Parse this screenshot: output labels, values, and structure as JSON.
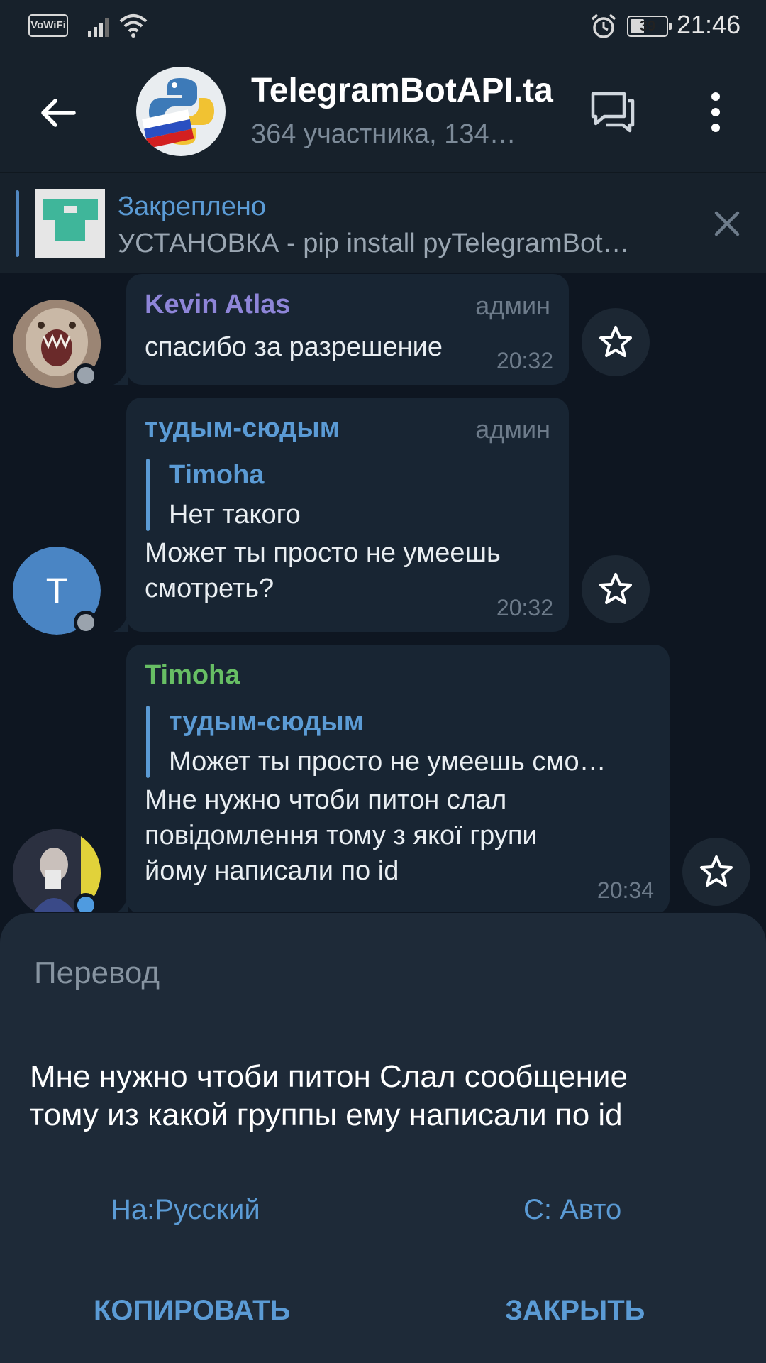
{
  "status_bar": {
    "vowifi": "VoWiFi",
    "battery": "39",
    "battery_level": 0.39,
    "time": "21:46",
    "icons": [
      "signal-icon",
      "wifi-icon",
      "alarm-icon",
      "battery-icon"
    ]
  },
  "header": {
    "title": "TelegramBotAPI.ta",
    "subtitle": "364 участника, 134…",
    "icons": [
      "back-arrow-icon",
      "discussion-icon",
      "more-vert-icon"
    ]
  },
  "pinned": {
    "title": "Закреплено",
    "text": "УСТАНОВКА - pip install pyTelegramBot…"
  },
  "messages": [
    {
      "sender": "Kevin Atlas",
      "sender_color": "#8e85d8",
      "badge": "админ",
      "text": "спасибо за разрешение",
      "time": "20:32"
    },
    {
      "sender": "тудым-сюдым",
      "sender_color": "#5b9bd5",
      "badge": "админ",
      "avatar_letter": "T",
      "avatar_color": "#4a85c4",
      "reply_name": "Timoha",
      "reply_text": "Нет такого",
      "text_line1": "Может ты просто не умеешь",
      "text_line2": "смотреть?",
      "time": "20:32"
    },
    {
      "sender": "Timoha",
      "sender_color": "#67be64",
      "reply_name": "тудым-сюдым",
      "reply_text": "Может ты просто не умеешь смо…",
      "text_line1": "Мне нужно чтоби питон слал",
      "text_line2": "повідомлення тому з якої групи",
      "text_line3": "йому написали по id",
      "time": "20:34"
    }
  ],
  "translation": {
    "title": "Перевод",
    "text_line1": "Мне нужно чтоби питон Слал сообщение",
    "text_line2": "тому из какой группы ему написали по id",
    "to_label": "На:Русский",
    "from_label": "С: Авто",
    "copy_button": "КОПИРОВАТЬ",
    "close_button": "ЗАКРЫТЬ"
  }
}
